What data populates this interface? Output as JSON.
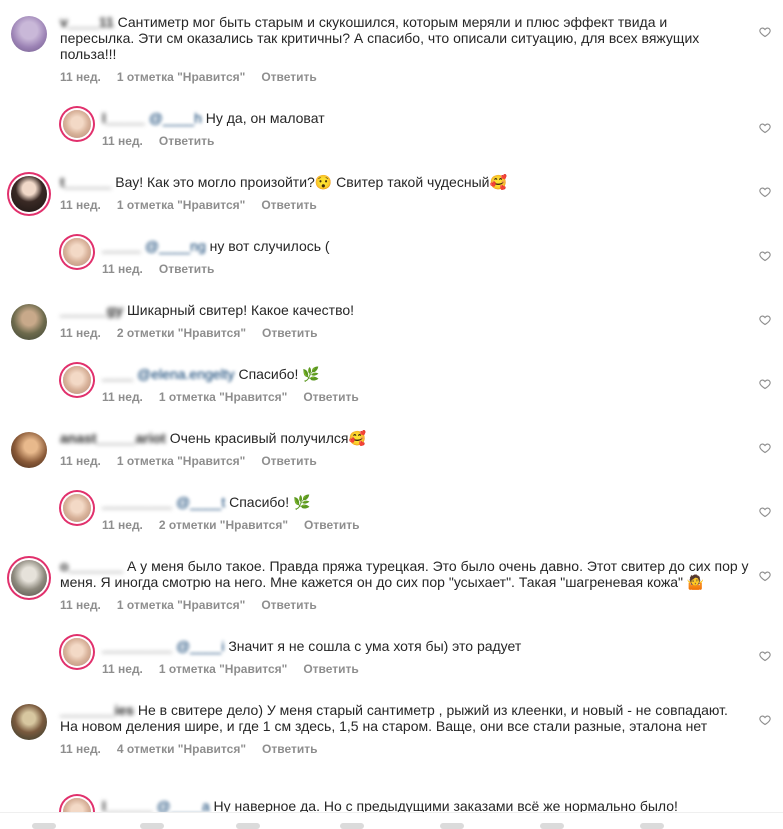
{
  "comments": [
    {
      "user": "v____11",
      "mention": "",
      "text": "Сантиметр мог быть старым и скукошился, которым меряли и плюс эффект твида и пересылка. Эти см оказались так критичны? А спасибо, что описали ситуацию, для всех вяжущих польза!!!",
      "time": "11 нед.",
      "likes": "1 отметка \"Нравится\"",
      "reply": "Ответить",
      "emoji": ""
    },
    {
      "user": "l_____",
      "mention": "@____h",
      "text": "Ну да,  он маловат",
      "time": "11 нед.",
      "likes": "",
      "reply": "Ответить",
      "emoji": ""
    },
    {
      "user": "t______",
      "mention": "",
      "text": "Вау! Как это могло произойти?😯 Свитер такой чудесный🥰",
      "time": "11 нед.",
      "likes": "1 отметка \"Нравится\"",
      "reply": "Ответить",
      "emoji": ""
    },
    {
      "user": "_____",
      "mention": "@____ng",
      "text": "ну вот случилось (",
      "time": "11 нед.",
      "likes": "",
      "reply": "Ответить",
      "emoji": ""
    },
    {
      "user": "______gy",
      "mention": "",
      "text": "Шикарный свитер! Какое качество!",
      "time": "11 нед.",
      "likes": "2 отметки \"Нравится\"",
      "reply": "Ответить",
      "emoji": ""
    },
    {
      "user": "____",
      "mention": "@elena.engelty",
      "text": "Спасибо! 🌿",
      "time": "11 нед.",
      "likes": "1 отметка \"Нравится\"",
      "reply": "Ответить",
      "emoji": ""
    },
    {
      "user": "anast_____ariot",
      "mention": "",
      "text": "Очень красивый получился🥰",
      "time": "11 нед.",
      "likes": "1 отметка \"Нравится\"",
      "reply": "Ответить",
      "emoji": ""
    },
    {
      "user": "_________",
      "mention": "@____t",
      "text": "Спасибо! 🌿",
      "time": "11 нед.",
      "likes": "2 отметки \"Нравится\"",
      "reply": "Ответить",
      "emoji": ""
    },
    {
      "user": "o_______",
      "mention": "",
      "text": "А у меня было такое. Правда пряжа турецкая. Это было очень давно. Этот свитер до сих пор у меня. Я иногда смотрю на него. Мне кажется он до сих пор \"усыхает\". Такая \"шагреневая кожа\" 🤷",
      "time": "11 нед.",
      "likes": "1 отметка \"Нравится\"",
      "reply": "Ответить",
      "emoji": ""
    },
    {
      "user": "_________",
      "mention": "@____i",
      "text": "Значит я не сошла с ума хотя бы)  это радует",
      "time": "11 нед.",
      "likes": "1 отметка \"Нравится\"",
      "reply": "Ответить",
      "emoji": ""
    },
    {
      "user": "_______ies",
      "mention": "",
      "text": "Не в свитере дело) У меня старый сантиметр , рыжий из клеенки, и новый - не совпадают. На новом деления шире, и где 1 см здесь, 1,5 на старом. Ваще, они все стали разные, эталона нет",
      "time": "11 нед.",
      "likes": "4 отметки \"Нравится\"",
      "reply": "Ответить",
      "emoji": ""
    },
    {
      "user": "l______",
      "mention": "@____a",
      "text": "Ну наверное да.  Но с предыдущими заказами всё же нормально было!",
      "time": "",
      "likes": "",
      "reply": "",
      "emoji": ""
    }
  ],
  "colors": {
    "accent_ring": "#e1306c",
    "meta": "#8e8e8e",
    "mention": "#00376b"
  },
  "icons": {
    "like": "heart-outline-icon"
  }
}
